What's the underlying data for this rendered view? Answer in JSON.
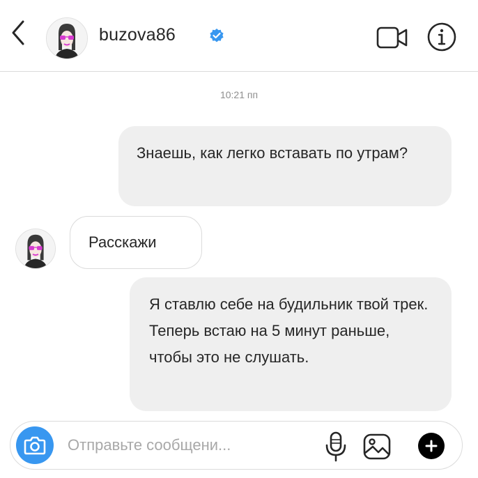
{
  "header": {
    "username": "buzova86",
    "verified": true,
    "icons": {
      "back": "chevron-left-icon",
      "verified": "verified-badge-icon",
      "video": "video-camera-icon",
      "info": "info-icon"
    }
  },
  "conversation": {
    "timestamp": "10:21 пп",
    "messages": [
      {
        "direction": "outgoing",
        "text": "Знаешь, как легко вставать по утрам?"
      },
      {
        "direction": "incoming",
        "text": "Расскажи"
      },
      {
        "direction": "outgoing",
        "text": "Я ставлю себе на будильник твой трек. Теперь встаю на 5 минут раньше, чтобы это не слушать."
      }
    ]
  },
  "composer": {
    "placeholder": "Отправьте сообщени...",
    "value": "",
    "icons": {
      "camera": "camera-icon",
      "mic": "microphone-icon",
      "gallery": "image-gallery-icon",
      "plus": "plus-icon"
    }
  },
  "colors": {
    "accent": "#3897f0",
    "verified": "#3897f0",
    "bubble_outgoing": "#efefef",
    "border": "#dbdbdb",
    "avatar_accent": "#d63ad0"
  }
}
